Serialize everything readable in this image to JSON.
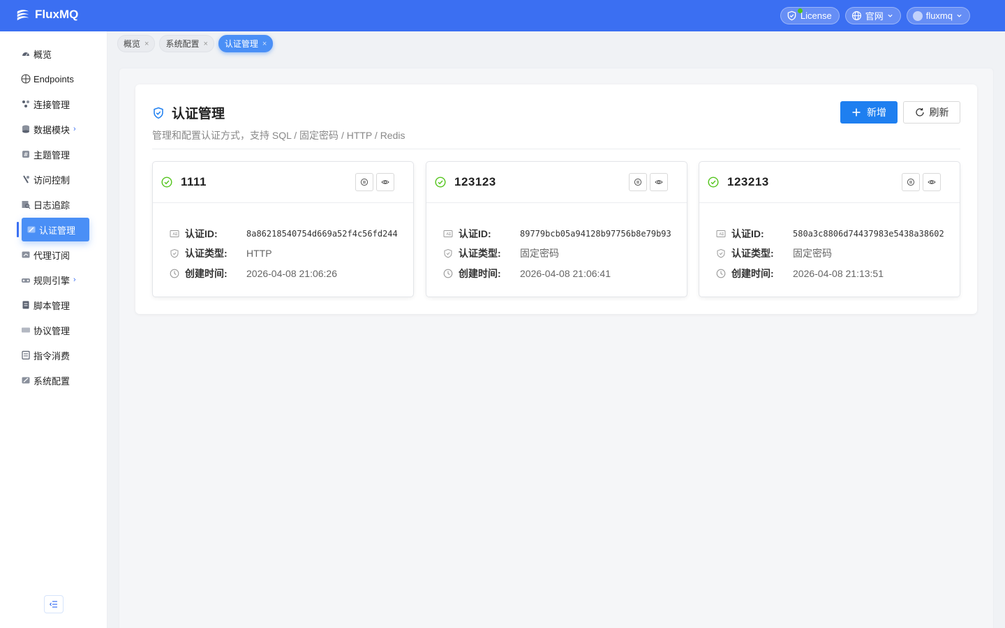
{
  "app": {
    "name": "FluxMQ"
  },
  "header": {
    "license_label": "License",
    "website_label": "官网",
    "user_label": "fluxmq"
  },
  "sidebar": {
    "items": [
      {
        "label": "概览",
        "icon": "dashboard-icon"
      },
      {
        "label": "Endpoints",
        "icon": "crosshair-icon"
      },
      {
        "label": "连接管理",
        "icon": "connections-icon"
      },
      {
        "label": "数据模块",
        "icon": "database-icon",
        "has_arrow": true
      },
      {
        "label": "主题管理",
        "icon": "topic-icon"
      },
      {
        "label": "访问控制",
        "icon": "access-icon"
      },
      {
        "label": "日志追踪",
        "icon": "log-icon"
      },
      {
        "label": "认证管理",
        "icon": "auth-icon",
        "active": true
      },
      {
        "label": "代理订阅",
        "icon": "proxy-icon"
      },
      {
        "label": "规则引擎",
        "icon": "rules-icon",
        "has_arrow": true
      },
      {
        "label": "脚本管理",
        "icon": "script-icon"
      },
      {
        "label": "协议管理",
        "icon": "protocol-icon"
      },
      {
        "label": "指令消费",
        "icon": "command-icon"
      },
      {
        "label": "系统配置",
        "icon": "settings-icon"
      }
    ],
    "arrow": "›"
  },
  "tabs": [
    {
      "label": "概览"
    },
    {
      "label": "系统配置"
    },
    {
      "label": "认证管理",
      "active": true
    }
  ],
  "page": {
    "title": "认证管理",
    "subtitle": "管理和配置认证方式，支持 SQL / 固定密码 / HTTP / Redis",
    "add_label": "新增",
    "refresh_label": "刷新"
  },
  "field_labels": {
    "id": "认证ID:",
    "type": "认证类型:",
    "created": "创建时间:"
  },
  "cards": [
    {
      "name": "1111",
      "id": "8a86218540754d669a52f4c56fd244",
      "type": "HTTP",
      "created": "2026-04-08 21:06:26"
    },
    {
      "name": "123123",
      "id": "89779bcb05a94128b97756b8e79b93",
      "type": "固定密码",
      "created": "2026-04-08 21:06:41"
    },
    {
      "name": "123213",
      "id": "580a3c8806d74437983e5438a38602",
      "type": "固定密码",
      "created": "2026-04-08 21:13:51"
    }
  ],
  "colors": {
    "primary": "#3b6ff2",
    "accent": "#1e7ff0",
    "success": "#52c41a"
  }
}
